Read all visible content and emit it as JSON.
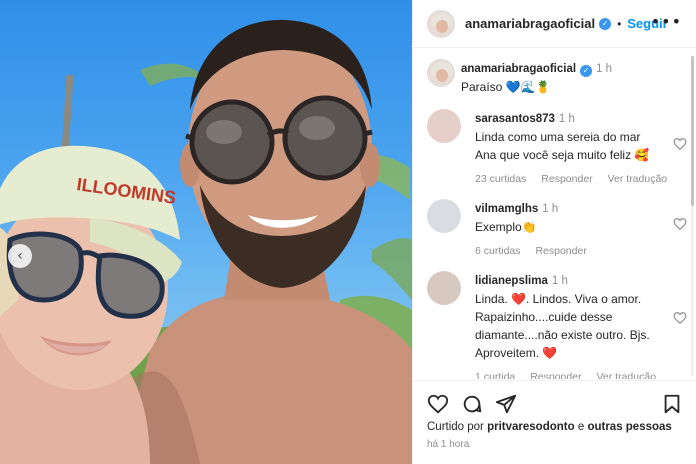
{
  "header": {
    "username": "anamariabragaoficial",
    "follow_label": "Seguir",
    "dot": "•",
    "more_icon": "more-options-icon"
  },
  "caption": {
    "username": "anamariabragaoficial",
    "time": "1 h",
    "text": "Paraíso 💙🌊🍍"
  },
  "comments": [
    {
      "username": "sarasantos873",
      "time": "1 h",
      "text": "Linda como uma sereia do mar Ana que você seja muito feliz 🥰",
      "likes": "23 curtidas",
      "reply": "Responder",
      "translate": "Ver tradução",
      "avatar_color": "#e6cfc8"
    },
    {
      "username": "vilmamglhs",
      "time": "1 h",
      "text": "Exemplo👏",
      "likes": "6 curtidas",
      "reply": "Responder",
      "translate": "",
      "avatar_color": "#d9dde2"
    },
    {
      "username": "lidianepslima",
      "time": "1 h",
      "text": "Linda. ❤️. Lindos. Viva o amor. Rapaizinho....cuide desse diamante....não existe outro. Bjs. Aproveitem. ❤️",
      "likes": "1 curtida",
      "reply": "Responder",
      "translate": "Ver tradução",
      "avatar_color": "#d8c9c0"
    }
  ],
  "actions": {
    "liked_prefix": "Curtido por ",
    "liked_user": "pritvaresodonto",
    "liked_suffix": " e ",
    "liked_others": "outras pessoas",
    "post_time": "há 1 hora"
  },
  "photo": {
    "cap_text": "ILLOOMINS",
    "carousel_prev": "‹"
  },
  "colors": {
    "accent": "#0095f6",
    "verified": "#3897f0",
    "meta_text": "#8e8e8e"
  }
}
